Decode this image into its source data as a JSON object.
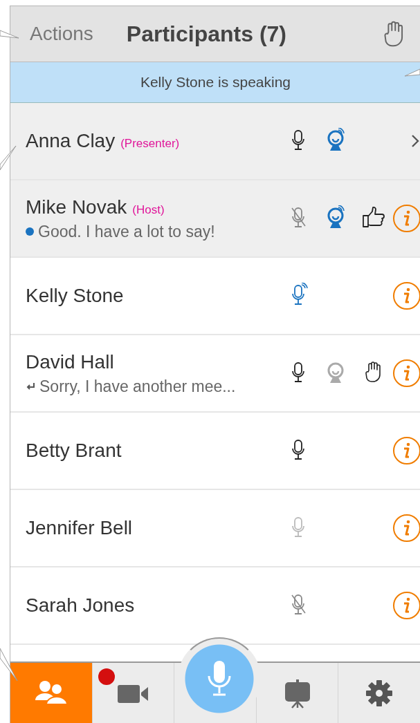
{
  "header": {
    "action": "Actions",
    "title": "Participants (7)"
  },
  "banner": "Kelly Stone is speaking",
  "participants": [
    {
      "name": "Anna Clay",
      "role": "(Presenter)",
      "selected": true,
      "icons": [
        {
          "kind": "mic",
          "speaking": false,
          "muted": false,
          "disabled": false
        },
        {
          "kind": "camera",
          "streaming": true
        },
        {
          "kind": "chevron"
        }
      ]
    },
    {
      "name": "Mike Novak",
      "role": "(Host)",
      "selected": true,
      "message": {
        "kind": "chat",
        "text": "Good. I have a lot to say!"
      },
      "icons": [
        {
          "kind": "mic",
          "speaking": false,
          "muted": true,
          "disabled": false
        },
        {
          "kind": "camera",
          "streaming": true
        },
        {
          "kind": "thumbsup"
        },
        {
          "kind": "info"
        }
      ]
    },
    {
      "name": "Kelly Stone",
      "selected": false,
      "icons": [
        {
          "kind": "mic",
          "speaking": true,
          "muted": false,
          "disabled": false
        },
        {
          "kind": "info"
        }
      ]
    },
    {
      "name": "David Hall",
      "selected": false,
      "message": {
        "kind": "reply",
        "text": "Sorry, I have another mee..."
      },
      "icons": [
        {
          "kind": "mic",
          "speaking": false,
          "muted": false,
          "disabled": false
        },
        {
          "kind": "camera",
          "streaming": false
        },
        {
          "kind": "hand"
        },
        {
          "kind": "info"
        }
      ]
    },
    {
      "name": "Betty Brant",
      "selected": false,
      "icons": [
        {
          "kind": "mic",
          "speaking": false,
          "muted": false,
          "disabled": false
        },
        {
          "kind": "info"
        }
      ]
    },
    {
      "name": "Jennifer Bell",
      "selected": false,
      "icons": [
        {
          "kind": "mic",
          "speaking": false,
          "muted": false,
          "disabled": true
        },
        {
          "kind": "info"
        }
      ]
    },
    {
      "name": "Sarah Jones",
      "selected": false,
      "icons": [
        {
          "kind": "mic",
          "speaking": false,
          "muted": true,
          "disabled": false
        },
        {
          "kind": "info"
        }
      ]
    }
  ],
  "tabs": [
    {
      "kind": "participants",
      "selected": true,
      "notification": false
    },
    {
      "kind": "video",
      "selected": false,
      "notification": true
    },
    {
      "kind": "mic",
      "selected": false,
      "notification": false
    },
    {
      "kind": "presentation",
      "selected": false,
      "notification": false
    },
    {
      "kind": "settings",
      "selected": false,
      "notification": false
    }
  ]
}
